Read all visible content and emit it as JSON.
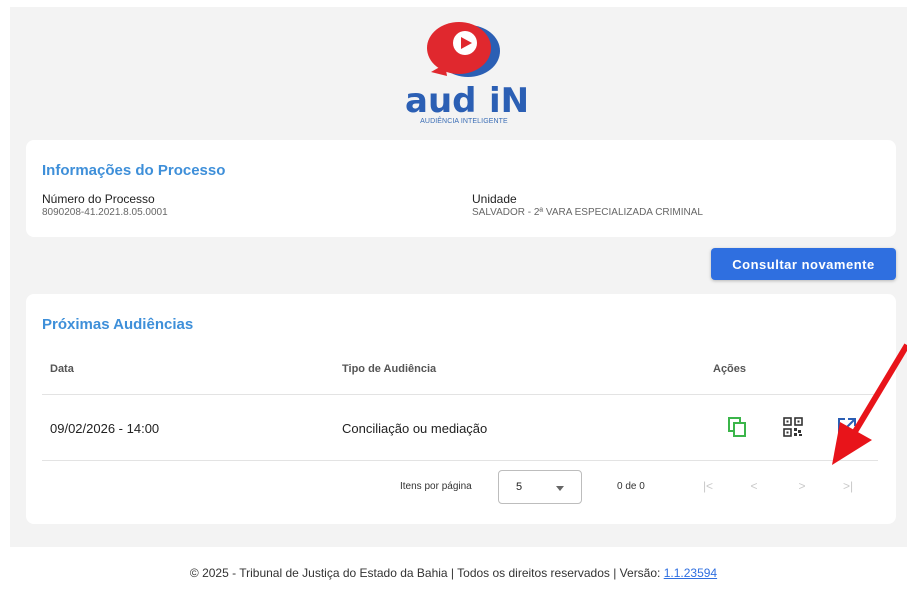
{
  "logo": {
    "text": "aud",
    "text_accent": "iN",
    "subtitle": "AUDIÊNCIA INTELIGENTE"
  },
  "info": {
    "title": "Informações do Processo",
    "numero_label": "Número do Processo",
    "numero_value": "8090208-41.2021.8.05.0001",
    "unidade_label": "Unidade",
    "unidade_value": "SALVADOR - 2ª VARA ESPECIALIZADA CRIMINAL"
  },
  "consultar_label": "Consultar novamente",
  "audiencias": {
    "title": "Próximas Audiências",
    "columns": [
      "Data",
      "Tipo de Audiência",
      "Ações"
    ],
    "rows": [
      {
        "data": "09/02/2026 - 14:00",
        "tipo": "Conciliação ou mediação"
      }
    ],
    "actions": [
      "copy-icon",
      "qr-code-icon",
      "open-in-new-icon"
    ],
    "pager": {
      "items_label": "Itens por página",
      "page_size": "5",
      "range": "0 de 0"
    }
  },
  "footer": {
    "text": "© 2025 - Tribunal de Justiça do Estado da Bahia | Todos os direitos reservados | Versão: ",
    "version": "1.1.23594"
  },
  "colors": {
    "accent_blue": "#2f6fe0",
    "title_blue": "#3e8fd9",
    "logo_red": "#e0282e",
    "logo_blue": "#2b5fb4",
    "action_green": "#3bb54a",
    "annotation_red": "#e8141a"
  }
}
